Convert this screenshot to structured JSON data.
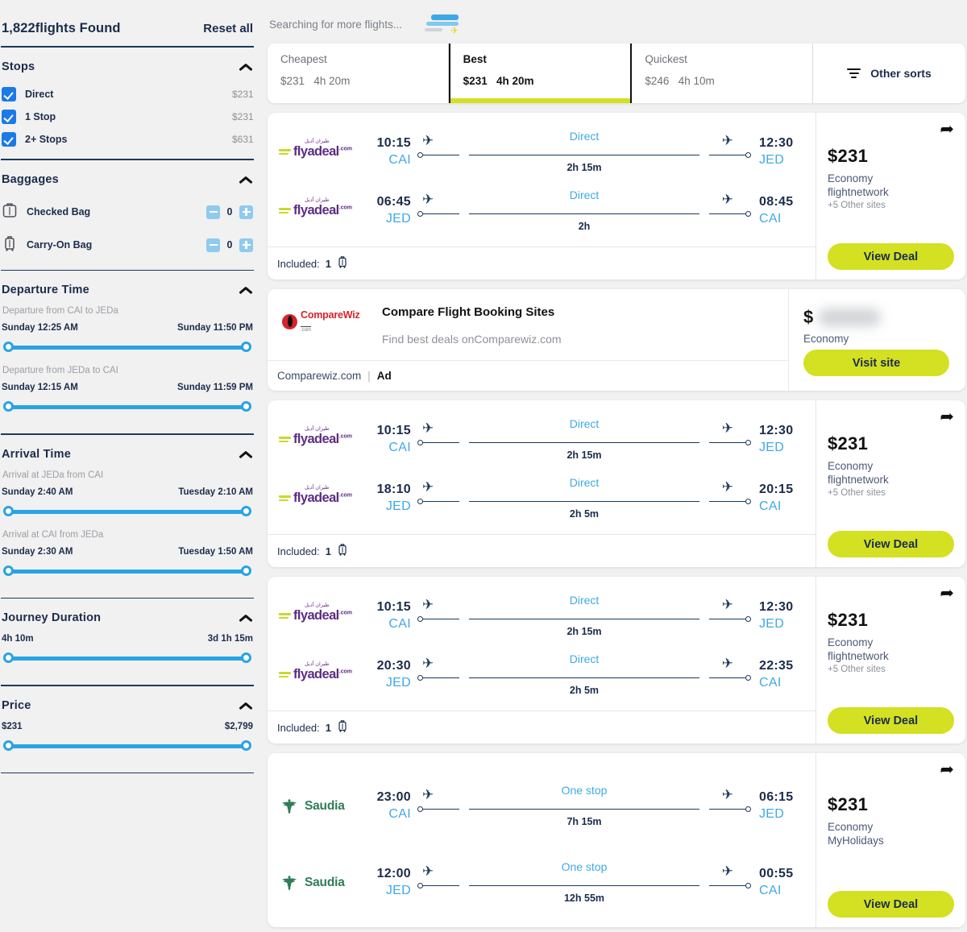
{
  "colors": {
    "accent_yellow": "#d4e022",
    "link_blue": "#3fa9e5",
    "slider_blue": "#29a3e3",
    "checkbox_blue": "#1a7ae8",
    "dark_navy": "#1b2c4b",
    "flyadeal_purple": "#5c2d82",
    "saudia_green": "#2e7d56",
    "comparewiz_red": "#d8232a"
  },
  "sidebar": {
    "found_text": "1,822flights Found",
    "reset_label": "Reset all",
    "stops": {
      "title": "Stops",
      "items": [
        {
          "label": "Direct",
          "price": "$231",
          "checked": true
        },
        {
          "label": "1 Stop",
          "price": "$231",
          "checked": true
        },
        {
          "label": "2+ Stops",
          "price": "$631",
          "checked": true
        }
      ]
    },
    "baggages": {
      "title": "Baggages",
      "items": [
        {
          "label": "Checked Bag",
          "value": "0",
          "icon": "checked-bag-icon"
        },
        {
          "label": "Carry-On Bag",
          "value": "0",
          "icon": "carry-on-bag-icon"
        }
      ]
    },
    "departure_time": {
      "title": "Departure Time",
      "ranges": [
        {
          "sub_label": "Departure from CAI to JEDa",
          "min": "Sunday 12:25 AM",
          "max": "Sunday 11:50 PM"
        },
        {
          "sub_label": "Departure from JEDa to CAI",
          "min": "Sunday 12:15 AM",
          "max": "Sunday 11:59 PM"
        }
      ]
    },
    "arrival_time": {
      "title": "Arrival Time",
      "ranges": [
        {
          "sub_label": "Arrival at JEDa from CAI",
          "min": "Sunday 2:40 AM",
          "max": "Tuesday 2:10 AM"
        },
        {
          "sub_label": "Arrival at CAI from JEDa",
          "min": "Sunday 2:30 AM",
          "max": "Tuesday 1:50 AM"
        }
      ]
    },
    "journey_duration": {
      "title": "Journey Duration",
      "min": "4h 10m",
      "max": "3d 1h 15m"
    },
    "price": {
      "title": "Price",
      "min": "$231",
      "max": "$2,799"
    }
  },
  "results": {
    "searching_text": "Searching for more flights...",
    "sorts": [
      {
        "label": "Cheapest",
        "price": "$231",
        "duration": "4h 20m",
        "active": false
      },
      {
        "label": "Best",
        "price": "$231",
        "duration": "4h 20m",
        "active": true
      },
      {
        "label": "Quickest",
        "price": "$246",
        "duration": "4h 10m",
        "active": false
      }
    ],
    "other_sorts_label": "Other sorts",
    "cards": [
      {
        "legs": [
          {
            "airline": "flyadeal",
            "arabic": "طيران أديل",
            "depart_time": "10:15",
            "depart_code": "CAI",
            "stops": "Direct",
            "duration": "2h 15m",
            "arrive_time": "12:30",
            "arrive_code": "JED"
          },
          {
            "airline": "flyadeal",
            "arabic": "طيران أديل",
            "depart_time": "06:45",
            "depart_code": "JED",
            "stops": "Direct",
            "duration": "2h",
            "arrive_time": "08:45",
            "arrive_code": "CAI"
          }
        ],
        "included_label": "Included:",
        "included_count": "1",
        "price": "$231",
        "cabin": "Economy",
        "provider": "flightnetwork",
        "other_sites": "+5 Other sites",
        "button_label": "View Deal"
      },
      {
        "legs": [
          {
            "airline": "flyadeal",
            "arabic": "طيران أديل",
            "depart_time": "10:15",
            "depart_code": "CAI",
            "stops": "Direct",
            "duration": "2h 15m",
            "arrive_time": "12:30",
            "arrive_code": "JED"
          },
          {
            "airline": "flyadeal",
            "arabic": "طيران أديل",
            "depart_time": "18:10",
            "depart_code": "JED",
            "stops": "Direct",
            "duration": "2h 5m",
            "arrive_time": "20:15",
            "arrive_code": "CAI"
          }
        ],
        "included_label": "Included:",
        "included_count": "1",
        "price": "$231",
        "cabin": "Economy",
        "provider": "flightnetwork",
        "other_sites": "+5 Other sites",
        "button_label": "View Deal"
      },
      {
        "legs": [
          {
            "airline": "flyadeal",
            "arabic": "طيران أديل",
            "depart_time": "10:15",
            "depart_code": "CAI",
            "stops": "Direct",
            "duration": "2h 15m",
            "arrive_time": "12:30",
            "arrive_code": "JED"
          },
          {
            "airline": "flyadeal",
            "arabic": "طيران أديل",
            "depart_time": "20:30",
            "depart_code": "JED",
            "stops": "Direct",
            "duration": "2h 5m",
            "arrive_time": "22:35",
            "arrive_code": "CAI"
          }
        ],
        "included_label": "Included:",
        "included_count": "1",
        "price": "$231",
        "cabin": "Economy",
        "provider": "flightnetwork",
        "other_sites": "+5 Other sites",
        "button_label": "View Deal"
      },
      {
        "legs": [
          {
            "airline": "Saudia",
            "depart_time": "23:00",
            "depart_code": "CAI",
            "stops": "One stop",
            "duration": "7h 15m",
            "arrive_time": "06:15",
            "arrive_code": "JED"
          },
          {
            "airline": "Saudia",
            "depart_time": "12:00",
            "depart_code": "JED",
            "stops": "One stop",
            "duration": "12h 55m",
            "arrive_time": "00:55",
            "arrive_code": "CAI"
          }
        ],
        "price": "$231",
        "cabin": "Economy",
        "provider": "MyHolidays",
        "button_label": "View Deal"
      }
    ],
    "ad": {
      "logo_name": "CompareWiz",
      "logo_sub": ".com",
      "title": "Compare Flight Booking Sites",
      "desc": "Find best deals onComparewiz.com",
      "footer_site": "Comparewiz.com",
      "footer_sep": "|",
      "footer_tag": "Ad",
      "dollar": "$",
      "cabin": "Economy",
      "button_label": "Visit site"
    }
  }
}
